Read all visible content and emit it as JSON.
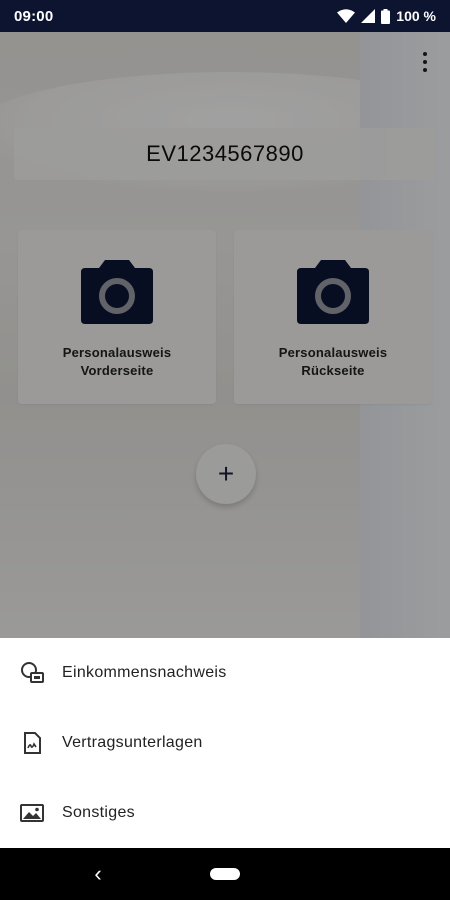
{
  "status_bar": {
    "time": "09:00",
    "battery": "100 %",
    "icons": [
      "wifi-icon",
      "cell-signal-icon",
      "battery-icon"
    ]
  },
  "app": {
    "id_number": "EV1234567890",
    "overflow_icon": "more-vert-icon",
    "cards": [
      {
        "icon": "camera-icon",
        "line1": "Personalausweis",
        "line2": "Vorderseite"
      },
      {
        "icon": "camera-icon",
        "line1": "Personalausweis",
        "line2": "Rückseite"
      }
    ],
    "fab_label": "+"
  },
  "sheet": {
    "items": [
      {
        "icon": "income-proof-icon",
        "label": "Einkommensnachweis"
      },
      {
        "icon": "contract-document-icon",
        "label": "Vertragsunterlagen"
      },
      {
        "icon": "image-icon",
        "label": "Sonstiges"
      }
    ]
  },
  "nav": {
    "back": "‹"
  },
  "colors": {
    "status_bar": "#0c1430",
    "camera_icon": "#0e1736",
    "scrim": "rgba(0,0,0,0.36)",
    "sheet_bg": "#ffffff",
    "nav_bar": "#000000"
  }
}
